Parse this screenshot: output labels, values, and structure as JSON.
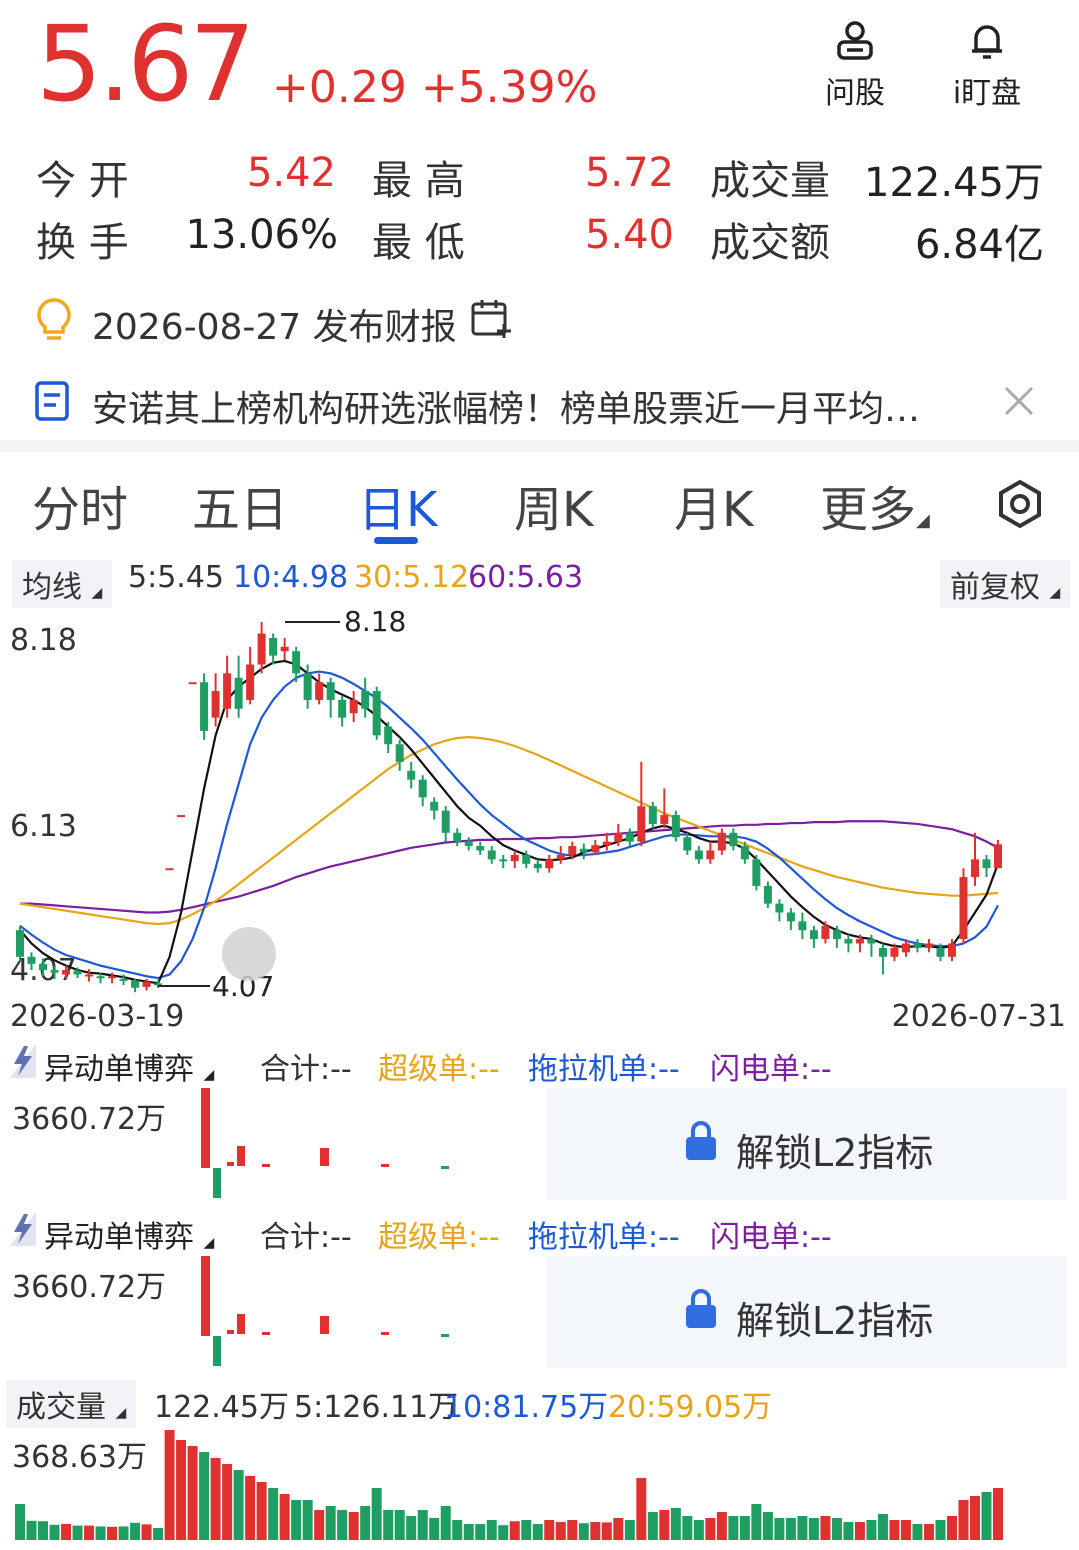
{
  "quote": {
    "price": "5.67",
    "change": "+0.29 +5.39%",
    "rows": [
      {
        "l1": "今 开",
        "v1": "5.42",
        "l2": "最 高",
        "v2": "5.72",
        "l3": "成交量",
        "v3": "122.45万"
      },
      {
        "l1": "换 手",
        "v1": "13.06%",
        "l2": "最 低",
        "v2": "5.40",
        "l3": "成交额",
        "v3": "6.84亿"
      }
    ]
  },
  "header_buttons": {
    "ask": "问股",
    "watch": "i盯盘"
  },
  "earnings": "2026-08-27 发布财报",
  "news": "安诺其上榜机构研选涨幅榜！榜单股票近一月平均…",
  "tabs": [
    "分时",
    "五日",
    "日K",
    "周K",
    "月K",
    "更多"
  ],
  "active_tab": "日K",
  "ma": {
    "label": "均线",
    "ma5": "5:5.45",
    "ma10": "10:4.98",
    "ma30": "30:5.12",
    "ma60": "60:5.63",
    "adjust": "前复权"
  },
  "colors": {
    "up": "#e03131",
    "down": "#1e9e62",
    "ma5": "#111111",
    "ma10": "#1d58d6",
    "ma30": "#e8a317",
    "ma60": "#7a1fa2"
  },
  "chart_data": {
    "type": "candlestick",
    "y_ticks": [
      "8.18",
      "6.13",
      "4.07"
    ],
    "x_start": "2026-03-19",
    "x_end": "2026-07-31",
    "high_label": "8.18",
    "low_label": "4.07",
    "ylim": [
      4.07,
      8.18
    ],
    "candles": [
      [
        4.7,
        4.4,
        4.75,
        4.35
      ],
      [
        4.4,
        4.32,
        4.45,
        4.25
      ],
      [
        4.32,
        4.25,
        4.38,
        4.18
      ],
      [
        4.25,
        4.22,
        4.3,
        4.15
      ],
      [
        4.2,
        4.25,
        4.3,
        4.15
      ],
      [
        4.24,
        4.2,
        4.28,
        4.16
      ],
      [
        4.18,
        4.2,
        4.26,
        4.12
      ],
      [
        4.18,
        4.16,
        4.22,
        4.1
      ],
      [
        4.17,
        4.18,
        4.22,
        4.1
      ],
      [
        4.15,
        4.13,
        4.2,
        4.08
      ],
      [
        4.13,
        4.05,
        4.15,
        4.0
      ],
      [
        4.06,
        4.12,
        4.15,
        4.02
      ],
      [
        4.1,
        4.09,
        4.14,
        4.05
      ],
      [
        5.4,
        5.4,
        5.4,
        5.4
      ],
      [
        6.0,
        6.0,
        6.0,
        6.0
      ],
      [
        7.5,
        7.5,
        7.5,
        7.5
      ],
      [
        7.5,
        6.95,
        7.6,
        6.85
      ],
      [
        7.1,
        7.4,
        7.6,
        7.0
      ],
      [
        7.2,
        7.6,
        7.8,
        7.1
      ],
      [
        7.55,
        7.2,
        7.8,
        7.1
      ],
      [
        7.3,
        7.7,
        7.9,
        7.25
      ],
      [
        7.7,
        8.05,
        8.18,
        7.6
      ],
      [
        8.0,
        7.8,
        8.05,
        7.7
      ],
      [
        7.85,
        7.9,
        8.0,
        7.75
      ],
      [
        7.85,
        7.6,
        7.9,
        7.5
      ],
      [
        7.6,
        7.3,
        7.7,
        7.2
      ],
      [
        7.3,
        7.5,
        7.6,
        7.25
      ],
      [
        7.5,
        7.3,
        7.55,
        7.1
      ],
      [
        7.3,
        7.1,
        7.35,
        7.0
      ],
      [
        7.15,
        7.3,
        7.4,
        7.05
      ],
      [
        7.4,
        7.2,
        7.55,
        7.1
      ],
      [
        7.4,
        6.9,
        7.45,
        6.85
      ],
      [
        7.0,
        6.8,
        7.05,
        6.7
      ],
      [
        6.8,
        6.6,
        6.85,
        6.5
      ],
      [
        6.5,
        6.4,
        6.6,
        6.3
      ],
      [
        6.4,
        6.2,
        6.45,
        6.1
      ],
      [
        6.15,
        6.05,
        6.2,
        5.95
      ],
      [
        6.05,
        5.8,
        6.1,
        5.7
      ],
      [
        5.8,
        5.7,
        5.85,
        5.65
      ],
      [
        5.7,
        5.65,
        5.75,
        5.6
      ],
      [
        5.65,
        5.6,
        5.7,
        5.55
      ],
      [
        5.6,
        5.5,
        5.65,
        5.45
      ],
      [
        5.5,
        5.48,
        5.55,
        5.4
      ],
      [
        5.48,
        5.55,
        5.6,
        5.4
      ],
      [
        5.55,
        5.45,
        5.6,
        5.4
      ],
      [
        5.45,
        5.4,
        5.5,
        5.35
      ],
      [
        5.4,
        5.5,
        5.55,
        5.35
      ],
      [
        5.5,
        5.55,
        5.65,
        5.45
      ],
      [
        5.55,
        5.65,
        5.7,
        5.5
      ],
      [
        5.62,
        5.58,
        5.68,
        5.5
      ],
      [
        5.58,
        5.66,
        5.72,
        5.55
      ],
      [
        5.66,
        5.7,
        5.8,
        5.6
      ],
      [
        5.7,
        5.8,
        5.9,
        5.65
      ],
      [
        5.8,
        5.7,
        5.85,
        5.65
      ],
      [
        5.7,
        6.1,
        6.6,
        5.65
      ],
      [
        6.1,
        5.9,
        6.15,
        5.85
      ],
      [
        5.9,
        6.0,
        6.3,
        5.85
      ],
      [
        6.0,
        5.75,
        6.05,
        5.7
      ],
      [
        5.75,
        5.6,
        5.8,
        5.55
      ],
      [
        5.6,
        5.5,
        5.65,
        5.45
      ],
      [
        5.5,
        5.6,
        5.7,
        5.45
      ],
      [
        5.6,
        5.8,
        5.85,
        5.55
      ],
      [
        5.8,
        5.65,
        5.85,
        5.6
      ],
      [
        5.65,
        5.5,
        5.7,
        5.45
      ],
      [
        5.5,
        5.2,
        5.55,
        5.15
      ],
      [
        5.2,
        5.0,
        5.25,
        4.95
      ],
      [
        5.0,
        4.9,
        5.05,
        4.8
      ],
      [
        4.9,
        4.8,
        4.95,
        4.7
      ],
      [
        4.8,
        4.7,
        4.9,
        4.6
      ],
      [
        4.7,
        4.6,
        4.75,
        4.5
      ],
      [
        4.6,
        4.75,
        4.8,
        4.55
      ],
      [
        4.7,
        4.6,
        4.75,
        4.5
      ],
      [
        4.6,
        4.55,
        4.65,
        4.45
      ],
      [
        4.55,
        4.6,
        4.65,
        4.45
      ],
      [
        4.6,
        4.55,
        4.65,
        4.4
      ],
      [
        4.5,
        4.4,
        4.55,
        4.2
      ],
      [
        4.4,
        4.5,
        4.55,
        4.35
      ],
      [
        4.45,
        4.55,
        4.6,
        4.4
      ],
      [
        4.55,
        4.5,
        4.6,
        4.45
      ],
      [
        4.5,
        4.55,
        4.6,
        4.45
      ],
      [
        4.5,
        4.4,
        4.55,
        4.35
      ],
      [
        4.4,
        4.55,
        4.6,
        4.35
      ],
      [
        4.6,
        5.3,
        5.4,
        4.55
      ],
      [
        5.3,
        5.5,
        5.8,
        5.2
      ],
      [
        5.5,
        5.4,
        5.55,
        5.3
      ],
      [
        5.4,
        5.67,
        5.72,
        5.4
      ]
    ],
    "ma_series": {
      "ma5": [
        4.7,
        4.55,
        4.44,
        4.36,
        4.3,
        4.25,
        4.22,
        4.21,
        4.19,
        4.17,
        4.14,
        4.12,
        4.1,
        4.4,
        4.9,
        5.6,
        6.3,
        6.9,
        7.3,
        7.45,
        7.55,
        7.65,
        7.72,
        7.74,
        7.7,
        7.6,
        7.5,
        7.42,
        7.36,
        7.3,
        7.22,
        7.12,
        7.0,
        6.88,
        6.74,
        6.58,
        6.42,
        6.26,
        6.1,
        5.97,
        5.88,
        5.76,
        5.66,
        5.6,
        5.55,
        5.5,
        5.49,
        5.5,
        5.52,
        5.58,
        5.62,
        5.66,
        5.7,
        5.74,
        5.8,
        5.85,
        5.88,
        5.84,
        5.8,
        5.74,
        5.7,
        5.7,
        5.68,
        5.62,
        5.5,
        5.36,
        5.22,
        5.08,
        4.96,
        4.85,
        4.76,
        4.7,
        4.65,
        4.62,
        4.6,
        4.55,
        4.52,
        4.51,
        4.52,
        4.52,
        4.5,
        4.52,
        4.7,
        4.9,
        5.1,
        5.45
      ],
      "ma10": [
        4.75,
        4.65,
        4.56,
        4.48,
        4.42,
        4.38,
        4.34,
        4.3,
        4.27,
        4.24,
        4.21,
        4.18,
        4.16,
        4.2,
        4.35,
        4.6,
        4.95,
        5.4,
        5.9,
        6.35,
        6.8,
        7.1,
        7.3,
        7.45,
        7.55,
        7.6,
        7.62,
        7.6,
        7.55,
        7.48,
        7.4,
        7.32,
        7.22,
        7.1,
        6.98,
        6.85,
        6.7,
        6.55,
        6.4,
        6.26,
        6.12,
        6.0,
        5.9,
        5.8,
        5.72,
        5.66,
        5.6,
        5.56,
        5.54,
        5.55,
        5.56,
        5.58,
        5.6,
        5.64,
        5.68,
        5.72,
        5.76,
        5.78,
        5.78,
        5.77,
        5.76,
        5.76,
        5.76,
        5.74,
        5.7,
        5.62,
        5.52,
        5.4,
        5.28,
        5.16,
        5.05,
        4.95,
        4.87,
        4.8,
        4.74,
        4.68,
        4.62,
        4.58,
        4.55,
        4.53,
        4.52,
        4.52,
        4.55,
        4.62,
        4.74,
        4.98
      ],
      "ma30": [
        5.0,
        4.98,
        4.96,
        4.94,
        4.92,
        4.9,
        4.88,
        4.86,
        4.84,
        4.82,
        4.8,
        4.78,
        4.77,
        4.78,
        4.82,
        4.88,
        4.95,
        5.03,
        5.12,
        5.22,
        5.32,
        5.42,
        5.52,
        5.62,
        5.72,
        5.82,
        5.92,
        6.02,
        6.12,
        6.22,
        6.32,
        6.42,
        6.52,
        6.6,
        6.68,
        6.74,
        6.8,
        6.84,
        6.87,
        6.88,
        6.87,
        6.85,
        6.82,
        6.78,
        6.73,
        6.68,
        6.62,
        6.56,
        6.5,
        6.44,
        6.38,
        6.32,
        6.26,
        6.2,
        6.14,
        6.08,
        6.02,
        5.97,
        5.92,
        5.87,
        5.82,
        5.77,
        5.72,
        5.67,
        5.62,
        5.57,
        5.52,
        5.47,
        5.42,
        5.38,
        5.34,
        5.3,
        5.27,
        5.24,
        5.21,
        5.18,
        5.16,
        5.14,
        5.12,
        5.11,
        5.1,
        5.09,
        5.09,
        5.1,
        5.11,
        5.12
      ],
      "ma60": [
        5.0,
        5.0,
        4.99,
        4.98,
        4.97,
        4.96,
        4.95,
        4.94,
        4.93,
        4.92,
        4.91,
        4.9,
        4.9,
        4.91,
        4.93,
        4.96,
        4.99,
        5.02,
        5.05,
        5.08,
        5.12,
        5.16,
        5.2,
        5.25,
        5.3,
        5.34,
        5.38,
        5.42,
        5.45,
        5.48,
        5.51,
        5.54,
        5.57,
        5.6,
        5.63,
        5.65,
        5.67,
        5.69,
        5.7,
        5.71,
        5.72,
        5.72,
        5.73,
        5.73,
        5.73,
        5.74,
        5.74,
        5.75,
        5.75,
        5.76,
        5.77,
        5.78,
        5.79,
        5.8,
        5.81,
        5.82,
        5.83,
        5.84,
        5.85,
        5.86,
        5.87,
        5.88,
        5.88,
        5.89,
        5.89,
        5.9,
        5.9,
        5.91,
        5.91,
        5.92,
        5.92,
        5.92,
        5.93,
        5.93,
        5.93,
        5.93,
        5.92,
        5.91,
        5.9,
        5.88,
        5.86,
        5.84,
        5.8,
        5.76,
        5.7,
        5.63
      ]
    }
  },
  "l2": {
    "title": "异动单博弈",
    "total": "合计:--",
    "super": "超级单:--",
    "tractor": "拖拉机单:--",
    "flash": "闪电单:--",
    "scale": "3660.72万",
    "unlock": "解锁L2指标"
  },
  "volume": {
    "label": "成交量",
    "current": "122.45万",
    "ma5": "5:126.11万",
    "ma10": "10:81.75万",
    "ma20": "20:59.05万",
    "scale": "368.63万"
  }
}
